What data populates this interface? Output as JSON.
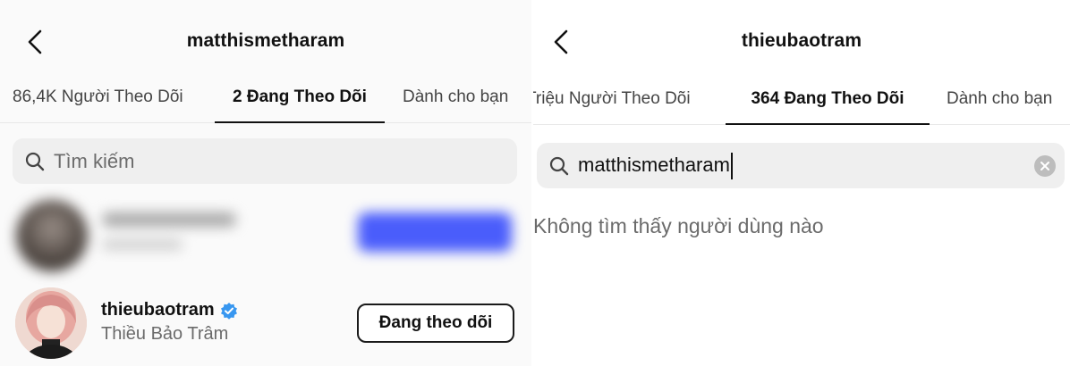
{
  "left": {
    "header_title": "matthismetharam",
    "tabs": [
      {
        "label": "86,4K Người Theo Dõi"
      },
      {
        "label": "2 Đang Theo Dõi"
      },
      {
        "label": "Dành cho bạn"
      }
    ],
    "search": {
      "placeholder": "Tìm kiếm"
    },
    "users": [
      {
        "username": "thieubaotram",
        "full_name": "Thiều Bảo Trâm",
        "button": "Đang theo dõi",
        "verified": true
      }
    ]
  },
  "right": {
    "header_title": "thieubaotram",
    "tabs": [
      {
        "label": "Triệu Người Theo Dõi"
      },
      {
        "label": "364 Đang Theo Dõi"
      },
      {
        "label": "Dành cho bạn"
      }
    ],
    "search": {
      "query": "matthismetharam"
    },
    "no_results": "Không tìm thấy người dùng nào"
  },
  "colors": {
    "verified_blue": "#3897f0",
    "blurred_button_blue": "#4a5dfb",
    "search_bg": "#efefef"
  }
}
